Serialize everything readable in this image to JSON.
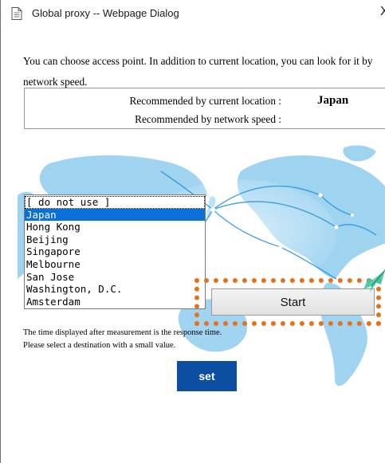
{
  "window": {
    "title": "Global proxy -- Webpage Dialog",
    "close_glyph": "X"
  },
  "intro": "You can choose access point. In addition to current location, you can look for it by network speed.",
  "recommendation": {
    "by_location_label": "Recommended by current location :",
    "by_location_value": "Japan",
    "by_speed_label": "Recommended by network speed :"
  },
  "access_points": {
    "options": [
      "[ do not use ]",
      "Japan",
      "Hong Kong",
      "Beijing",
      "Singapore",
      "Melbourne",
      "San Jose",
      "Washington, D.C.",
      "Amsterdam"
    ],
    "selected": "Japan"
  },
  "start_label": "Start",
  "note_lines": [
    "The time displayed after measurement is the response time.",
    "Please select a destination with a small value."
  ],
  "set_label": "set",
  "colors": {
    "selection": "#0a6fd6",
    "set_button": "#0b4ea2",
    "highlight": "#e6701c",
    "map": "#7cc3ea"
  }
}
